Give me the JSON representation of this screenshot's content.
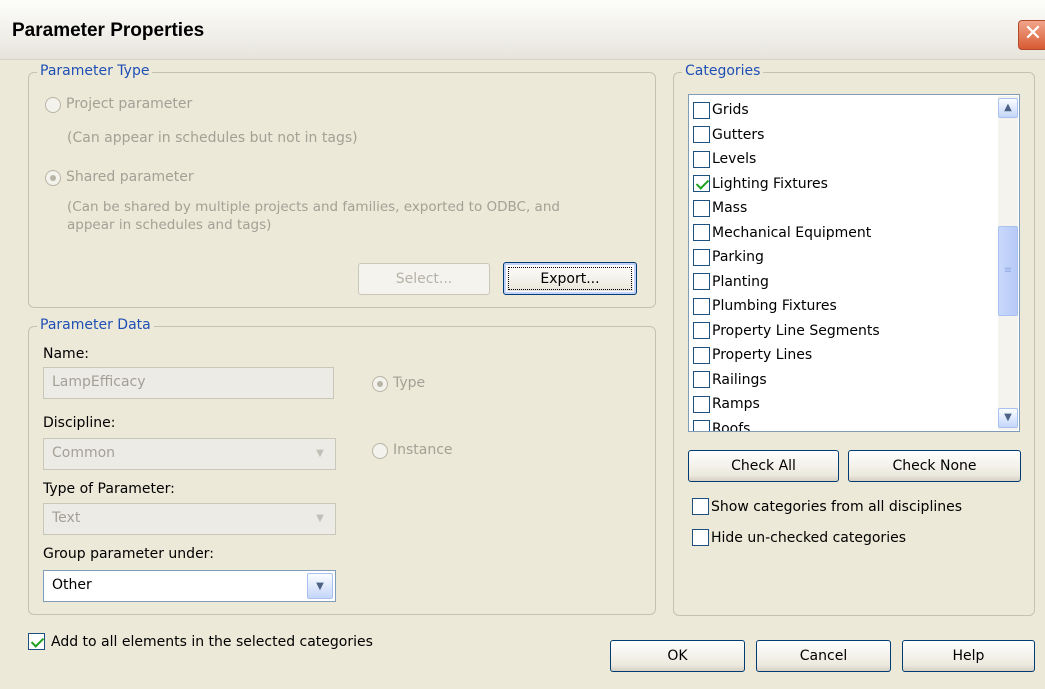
{
  "window": {
    "title": "Parameter Properties",
    "close_glyph": "✕"
  },
  "parameter_type": {
    "legend": "Parameter Type",
    "project_label": "Project parameter",
    "project_hint": "(Can appear in schedules but not in tags)",
    "shared_label": "Shared parameter",
    "shared_hint_line1": "(Can be shared by multiple projects and families, exported to ODBC, and",
    "shared_hint_line2": "appear in schedules and tags)",
    "select_label": "Select...",
    "export_label": "Export..."
  },
  "parameter_data": {
    "legend": "Parameter Data",
    "name_label": "Name:",
    "name_value": "LampEfficacy",
    "type_radio_label": "Type",
    "discipline_label": "Discipline:",
    "discipline_value": "Common",
    "instance_radio_label": "Instance",
    "type_of_param_label": "Type of Parameter:",
    "type_of_param_value": "Text",
    "group_label": "Group parameter under:",
    "group_value": "Other"
  },
  "categories": {
    "legend": "Categories",
    "items": [
      {
        "label": "Grids",
        "checked": false
      },
      {
        "label": "Gutters",
        "checked": false
      },
      {
        "label": "Levels",
        "checked": false
      },
      {
        "label": "Lighting Fixtures",
        "checked": true
      },
      {
        "label": "Mass",
        "checked": false
      },
      {
        "label": "Mechanical Equipment",
        "checked": false
      },
      {
        "label": "Parking",
        "checked": false
      },
      {
        "label": "Planting",
        "checked": false
      },
      {
        "label": "Plumbing Fixtures",
        "checked": false
      },
      {
        "label": "Property Line Segments",
        "checked": false
      },
      {
        "label": "Property Lines",
        "checked": false
      },
      {
        "label": "Railings",
        "checked": false
      },
      {
        "label": "Ramps",
        "checked": false
      },
      {
        "label": "Roofs",
        "checked": false
      }
    ],
    "check_all_label": "Check All",
    "check_none_label": "Check None",
    "show_all_label": "Show categories from all disciplines",
    "hide_unchecked_label": "Hide un-checked categories"
  },
  "footer": {
    "add_to_all_label": "Add to all elements in the selected categories",
    "add_to_all_checked": true,
    "ok_label": "OK",
    "cancel_label": "Cancel",
    "help_label": "Help"
  },
  "colors": {
    "legend": "#1f4fb5",
    "dialog_bg": "#ece9d8",
    "check": "#21a121"
  },
  "icons": {
    "close": "close-icon",
    "combo_arrow": "chevron-down-icon",
    "scroll_up": "chevron-up-icon",
    "scroll_down": "chevron-down-icon",
    "check": "checkmark-icon"
  }
}
